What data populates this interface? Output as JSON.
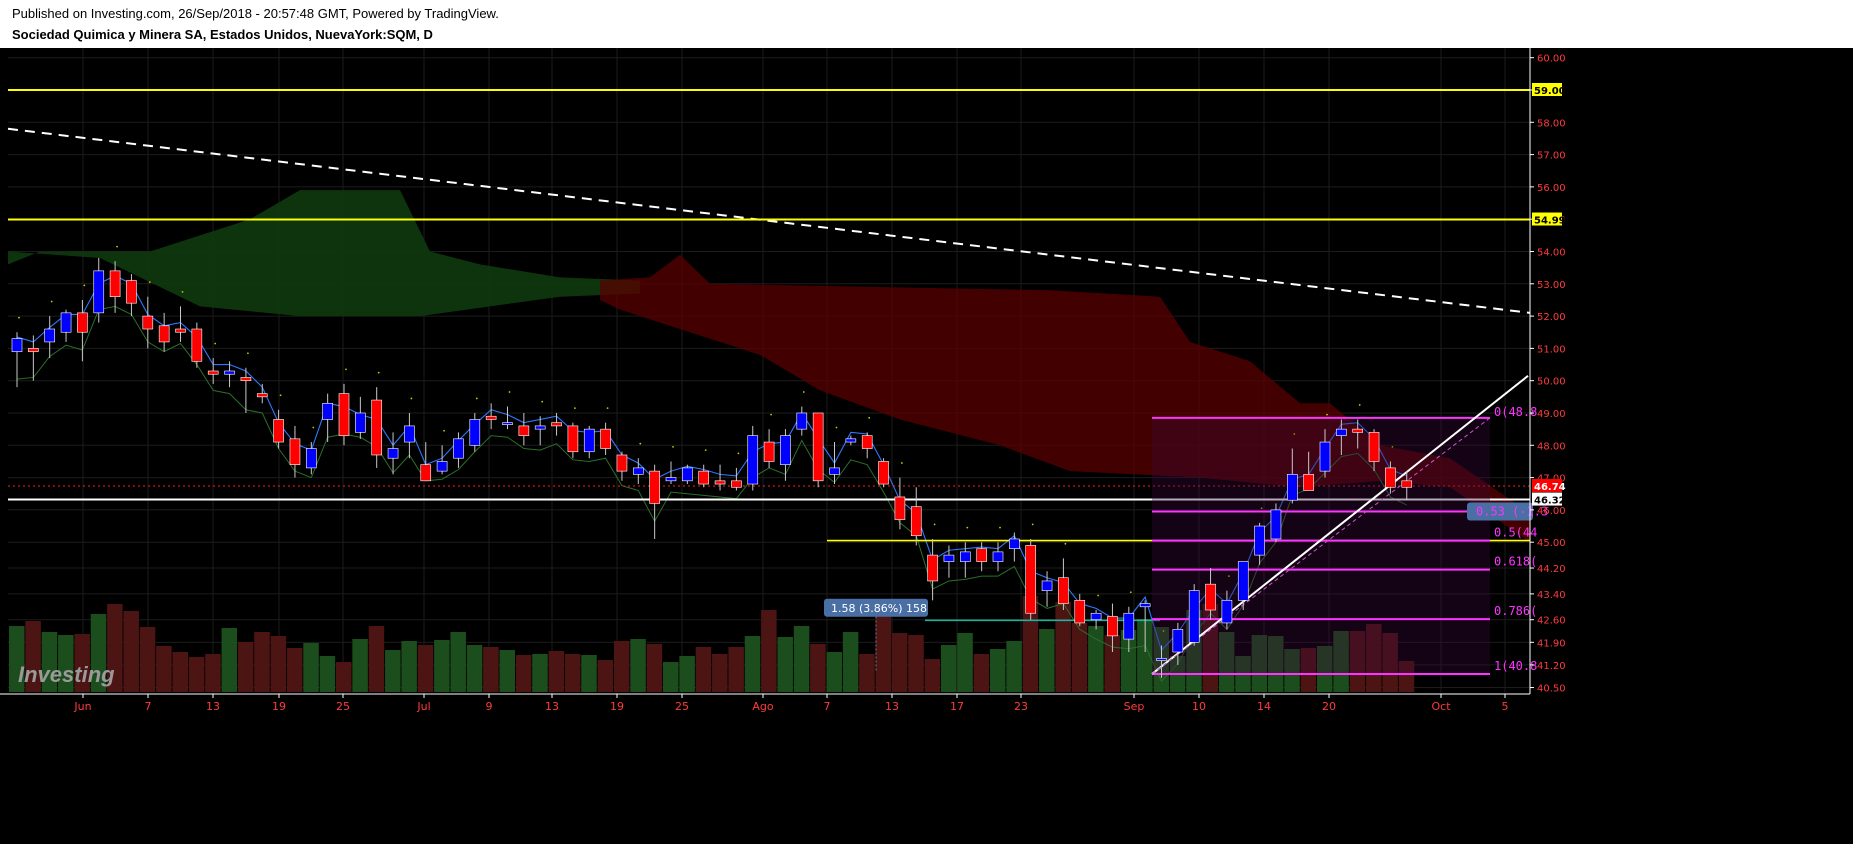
{
  "header": {
    "published": "Published on Investing.com, 26/Sep/2018 - 20:57:48 GMT, Powered by TradingView.",
    "title": "Sociedad Quimica y Minera SA, Estados Unidos, NuevaYork:SQM, D"
  },
  "logo": "Investing",
  "colors": {
    "background": "#000000",
    "up_candle": "#0000ff",
    "down_candle": "#ff0000",
    "horizontal_level": "#ffff00",
    "fib_level": "#ff33ff",
    "axis_text": "#ff3b3b",
    "kumo_bear": "#5a0000",
    "kumo_bull": "#0f3a0f"
  },
  "chart_data": {
    "type": "candlestick",
    "ylim": [
      40.3,
      60.3
    ],
    "y_ticks": [
      "60.00",
      "59.00",
      "58.00",
      "57.00",
      "56.00",
      "55.00",
      "54.00",
      "53.00",
      "52.00",
      "51.00",
      "50.00",
      "49.00",
      "48.00",
      "47.00",
      "46.00",
      "45.00",
      "44.20",
      "43.40",
      "42.60",
      "41.90",
      "41.20",
      "40.50"
    ],
    "x_ticks": [
      "Jun",
      "7",
      "13",
      "19",
      "25",
      "Jul",
      "9",
      "13",
      "19",
      "25",
      "Ago",
      "7",
      "13",
      "17",
      "23",
      "Sep",
      "10",
      "14",
      "20",
      "Oct",
      "5"
    ],
    "price_labels": [
      {
        "value": 59.0,
        "text": "59.00",
        "bg": "#ffff00",
        "color": "#000000"
      },
      {
        "value": 54.99,
        "text": "54.99",
        "bg": "#ffff00",
        "color": "#000000"
      },
      {
        "value": 46.74,
        "text": "46.74",
        "bg": "#ff0000",
        "color": "#ffffff"
      },
      {
        "value": 46.32,
        "text": "46.32",
        "bg": "#ffffff",
        "color": "#000000"
      }
    ],
    "horizontal_levels": [
      59.0,
      54.99,
      46.32
    ],
    "support_segment": 45.05,
    "measure_label": "1.58 (3.86%) 158",
    "fib_levels": [
      {
        "value": 48.85,
        "label": "0(48.8"
      },
      {
        "value": 45.95,
        "label": "0.53 (-1.3"
      },
      {
        "value": 45.05,
        "label": "0.5(44"
      },
      {
        "value": 44.15,
        "label": "0.618("
      },
      {
        "value": 42.62,
        "label": "0.786("
      },
      {
        "value": 40.92,
        "label": "1(40.8"
      }
    ],
    "candles": [
      {
        "o": 50.9,
        "h": 51.5,
        "l": 49.8,
        "c": 51.3
      },
      {
        "o": 51.0,
        "h": 51.4,
        "l": 50.0,
        "c": 50.9
      },
      {
        "o": 51.2,
        "h": 52.0,
        "l": 50.7,
        "c": 51.6
      },
      {
        "o": 51.5,
        "h": 52.2,
        "l": 51.2,
        "c": 52.1
      },
      {
        "o": 52.1,
        "h": 52.5,
        "l": 50.6,
        "c": 51.5
      },
      {
        "o": 52.1,
        "h": 53.8,
        "l": 51.8,
        "c": 53.4
      },
      {
        "o": 53.4,
        "h": 53.7,
        "l": 52.1,
        "c": 52.6
      },
      {
        "o": 53.1,
        "h": 53.3,
        "l": 52.0,
        "c": 52.4
      },
      {
        "o": 52.0,
        "h": 52.6,
        "l": 51.0,
        "c": 51.6
      },
      {
        "o": 51.7,
        "h": 52.1,
        "l": 50.9,
        "c": 51.2
      },
      {
        "o": 51.6,
        "h": 52.3,
        "l": 51.2,
        "c": 51.5
      },
      {
        "o": 51.6,
        "h": 51.8,
        "l": 50.4,
        "c": 50.6
      },
      {
        "o": 50.3,
        "h": 50.7,
        "l": 49.9,
        "c": 50.2
      },
      {
        "o": 50.2,
        "h": 50.6,
        "l": 49.8,
        "c": 50.3
      },
      {
        "o": 50.1,
        "h": 50.4,
        "l": 49.0,
        "c": 50.0
      },
      {
        "o": 49.6,
        "h": 49.9,
        "l": 49.3,
        "c": 49.5
      },
      {
        "o": 48.8,
        "h": 49.1,
        "l": 47.9,
        "c": 48.1
      },
      {
        "o": 48.2,
        "h": 48.6,
        "l": 47.0,
        "c": 47.4
      },
      {
        "o": 47.3,
        "h": 48.1,
        "l": 47.1,
        "c": 47.9
      },
      {
        "o": 48.8,
        "h": 49.6,
        "l": 48.1,
        "c": 49.3
      },
      {
        "o": 49.6,
        "h": 49.9,
        "l": 48.0,
        "c": 48.3
      },
      {
        "o": 48.4,
        "h": 49.5,
        "l": 48.2,
        "c": 49.0
      },
      {
        "o": 49.4,
        "h": 49.8,
        "l": 47.3,
        "c": 47.7
      },
      {
        "o": 47.6,
        "h": 48.4,
        "l": 47.1,
        "c": 47.9
      },
      {
        "o": 48.1,
        "h": 49.0,
        "l": 47.6,
        "c": 48.6
      },
      {
        "o": 47.4,
        "h": 48.1,
        "l": 46.9,
        "c": 46.9
      },
      {
        "o": 47.2,
        "h": 48.0,
        "l": 47.1,
        "c": 47.5
      },
      {
        "o": 47.6,
        "h": 48.4,
        "l": 47.3,
        "c": 48.2
      },
      {
        "o": 48.0,
        "h": 49.0,
        "l": 47.8,
        "c": 48.8
      },
      {
        "o": 48.9,
        "h": 49.3,
        "l": 48.5,
        "c": 48.8
      },
      {
        "o": 48.7,
        "h": 49.2,
        "l": 48.5,
        "c": 48.7
      },
      {
        "o": 48.6,
        "h": 49.0,
        "l": 48.0,
        "c": 48.3
      },
      {
        "o": 48.5,
        "h": 48.9,
        "l": 48.0,
        "c": 48.6
      },
      {
        "o": 48.7,
        "h": 49.0,
        "l": 48.3,
        "c": 48.6
      },
      {
        "o": 48.6,
        "h": 48.7,
        "l": 47.6,
        "c": 47.8
      },
      {
        "o": 47.8,
        "h": 48.6,
        "l": 47.6,
        "c": 48.5
      },
      {
        "o": 48.5,
        "h": 48.7,
        "l": 47.7,
        "c": 47.9
      },
      {
        "o": 47.7,
        "h": 47.8,
        "l": 46.9,
        "c": 47.2
      },
      {
        "o": 47.1,
        "h": 47.6,
        "l": 46.8,
        "c": 47.3
      },
      {
        "o": 47.2,
        "h": 47.4,
        "l": 45.1,
        "c": 46.2
      },
      {
        "o": 46.9,
        "h": 47.5,
        "l": 46.8,
        "c": 47.0
      },
      {
        "o": 46.9,
        "h": 47.4,
        "l": 46.8,
        "c": 47.3
      },
      {
        "o": 47.2,
        "h": 47.4,
        "l": 46.7,
        "c": 46.8
      },
      {
        "o": 46.9,
        "h": 47.4,
        "l": 46.6,
        "c": 46.8
      },
      {
        "o": 46.9,
        "h": 47.3,
        "l": 46.6,
        "c": 46.7
      },
      {
        "o": 46.8,
        "h": 48.6,
        "l": 46.6,
        "c": 48.3
      },
      {
        "o": 48.1,
        "h": 48.5,
        "l": 47.3,
        "c": 47.5
      },
      {
        "o": 47.4,
        "h": 48.5,
        "l": 46.9,
        "c": 48.3
      },
      {
        "o": 48.5,
        "h": 49.2,
        "l": 48.3,
        "c": 49.0
      },
      {
        "o": 49.0,
        "h": 49.0,
        "l": 46.7,
        "c": 46.9
      },
      {
        "o": 47.1,
        "h": 48.1,
        "l": 46.8,
        "c": 47.3
      },
      {
        "o": 48.1,
        "h": 48.3,
        "l": 48.0,
        "c": 48.2
      },
      {
        "o": 48.3,
        "h": 48.4,
        "l": 47.6,
        "c": 47.9
      },
      {
        "o": 47.5,
        "h": 47.6,
        "l": 46.7,
        "c": 46.8
      },
      {
        "o": 46.4,
        "h": 47.0,
        "l": 45.4,
        "c": 45.7
      },
      {
        "o": 46.1,
        "h": 46.7,
        "l": 44.9,
        "c": 45.2
      },
      {
        "o": 44.6,
        "h": 45.1,
        "l": 43.2,
        "c": 43.8
      },
      {
        "o": 44.4,
        "h": 44.9,
        "l": 43.9,
        "c": 44.6
      },
      {
        "o": 44.4,
        "h": 45.0,
        "l": 43.9,
        "c": 44.7
      },
      {
        "o": 44.8,
        "h": 45.0,
        "l": 44.1,
        "c": 44.4
      },
      {
        "o": 44.4,
        "h": 45.0,
        "l": 44.1,
        "c": 44.7
      },
      {
        "o": 44.8,
        "h": 45.3,
        "l": 44.4,
        "c": 45.1
      },
      {
        "o": 44.9,
        "h": 45.1,
        "l": 42.6,
        "c": 42.8
      },
      {
        "o": 43.5,
        "h": 44.1,
        "l": 43.0,
        "c": 43.8
      },
      {
        "o": 43.9,
        "h": 44.5,
        "l": 42.9,
        "c": 43.1
      },
      {
        "o": 43.2,
        "h": 43.4,
        "l": 42.4,
        "c": 42.5
      },
      {
        "o": 42.6,
        "h": 42.9,
        "l": 42.3,
        "c": 42.8
      },
      {
        "o": 42.7,
        "h": 43.1,
        "l": 41.6,
        "c": 42.1
      },
      {
        "o": 42.0,
        "h": 43.0,
        "l": 41.6,
        "c": 42.8
      },
      {
        "o": 43.0,
        "h": 43.2,
        "l": 41.6,
        "c": 43.1
      },
      {
        "o": 41.4,
        "h": 41.8,
        "l": 40.8,
        "c": 41.4
      },
      {
        "o": 41.6,
        "h": 42.5,
        "l": 41.2,
        "c": 42.3
      },
      {
        "o": 41.9,
        "h": 43.7,
        "l": 41.8,
        "c": 43.5
      },
      {
        "o": 43.7,
        "h": 44.2,
        "l": 42.6,
        "c": 42.9
      },
      {
        "o": 42.5,
        "h": 43.5,
        "l": 42.3,
        "c": 43.2
      },
      {
        "o": 43.2,
        "h": 44.4,
        "l": 42.9,
        "c": 44.4
      },
      {
        "o": 44.6,
        "h": 45.6,
        "l": 44.3,
        "c": 45.5
      },
      {
        "o": 45.1,
        "h": 46.2,
        "l": 45.0,
        "c": 46.0
      },
      {
        "o": 46.3,
        "h": 47.9,
        "l": 46.2,
        "c": 47.1
      },
      {
        "o": 47.1,
        "h": 47.8,
        "l": 46.7,
        "c": 46.6
      },
      {
        "o": 47.2,
        "h": 48.5,
        "l": 47.0,
        "c": 48.1
      },
      {
        "o": 48.3,
        "h": 48.8,
        "l": 47.7,
        "c": 48.5
      },
      {
        "o": 48.5,
        "h": 48.8,
        "l": 47.9,
        "c": 48.4
      },
      {
        "o": 48.4,
        "h": 48.5,
        "l": 47.2,
        "c": 47.5
      },
      {
        "o": 47.3,
        "h": 47.5,
        "l": 46.5,
        "c": 46.7
      },
      {
        "o": 46.9,
        "h": 47.2,
        "l": 46.3,
        "c": 46.7
      }
    ],
    "volume": [
      66,
      71,
      60,
      57,
      58,
      78,
      88,
      81,
      65,
      46,
      40,
      35,
      38,
      64,
      50,
      60,
      56,
      44,
      49,
      36,
      30,
      53,
      66,
      42,
      51,
      47,
      52,
      60,
      47,
      45,
      42,
      37,
      38,
      41,
      38,
      37,
      32,
      51,
      53,
      48,
      30,
      36,
      45,
      38,
      45,
      56,
      82,
      55,
      66,
      48,
      40,
      60,
      38,
      78,
      59,
      57,
      33,
      47,
      59,
      38,
      43,
      51,
      96,
      63,
      90,
      69,
      66,
      57,
      62,
      73,
      65,
      36,
      82,
      88,
      60,
      36,
      57,
      56,
      43,
      44,
      46,
      61,
      61,
      68,
      59,
      31
    ]
  }
}
